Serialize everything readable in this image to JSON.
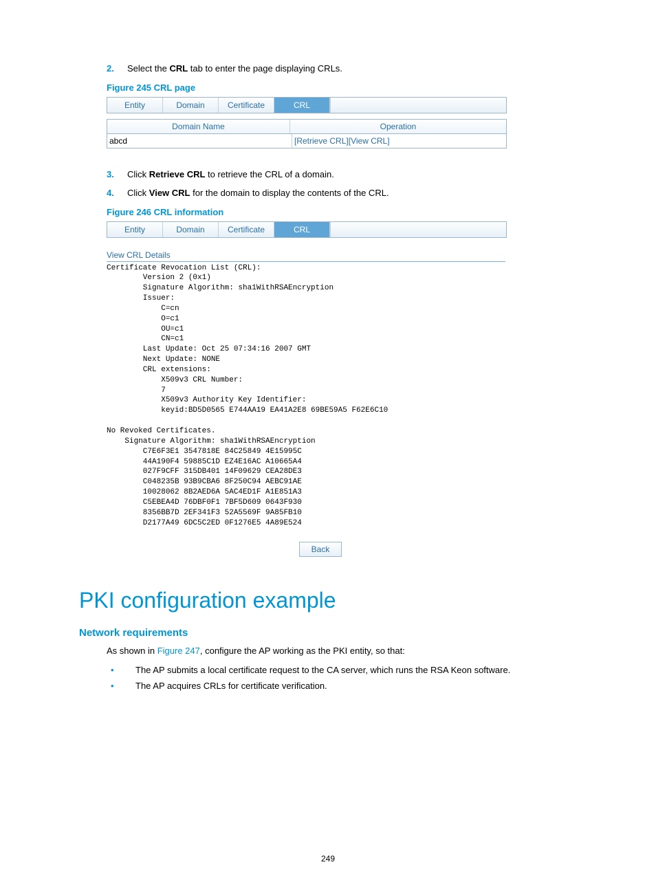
{
  "steps": {
    "s2_num": "2.",
    "s2_a": "Select the ",
    "s2_bold": "CRL",
    "s2_b": " tab to enter the page displaying CRLs.",
    "s3_num": "3.",
    "s3_a": "Click ",
    "s3_bold": "Retrieve CRL",
    "s3_b": " to retrieve the CRL of a domain.",
    "s4_num": "4.",
    "s4_a": "Click ",
    "s4_bold": "View CRL",
    "s4_b": " for the domain to display the contents of the CRL."
  },
  "fig245": {
    "caption": "Figure 245 CRL page",
    "tabs": {
      "entity": "Entity",
      "domain": "Domain",
      "certificate": "Certificate",
      "crl": "CRL"
    },
    "header": {
      "col1": "Domain Name",
      "col2": "Operation"
    },
    "row": {
      "name": "abcd",
      "op_retrieve": "Retrieve CRL",
      "op_view": "View CRL"
    }
  },
  "fig246": {
    "caption": "Figure 246 CRL information",
    "tabs": {
      "entity": "Entity",
      "domain": "Domain",
      "certificate": "Certificate",
      "crl": "CRL"
    },
    "details_label": "View CRL Details",
    "crl_text": "Certificate Revocation List (CRL):\n        Version 2 (0x1)\n        Signature Algorithm: sha1WithRSAEncryption\n        Issuer:\n            C=cn\n            O=c1\n            OU=c1\n            CN=c1\n        Last Update: Oct 25 07:34:16 2007 GMT\n        Next Update: NONE\n        CRL extensions:\n            X509v3 CRL Number:\n            7\n            X509v3 Authority Key Identifier:\n            keyid:BD5D0565 E744AA19 EA41A2E8 69BE59A5 F62E6C10\n\nNo Revoked Certificates.\n    Signature Algorithm: sha1WithRSAEncryption\n        C7E6F3E1 3547818E 84C25849 4E15995C\n        44A190F4 59885C1D EZ4E16AC A10665A4\n        027F9CFF 315DB401 14F09629 CEA28DE3\n        C048235B 93B9CBA6 8F250C94 AEBC91AE\n        10028062 8B2AED6A 5AC4ED1F A1E851A3\n        C5EBEA4D 76DBF0F1 7BF5D609 0643F930\n        8356BB7D 2EF341F3 52A5569F 9A85FB10\n        D2177A49 6DC5C2ED 0F1276E5 4A89E524",
    "back": "Back"
  },
  "pki": {
    "heading": "PKI configuration example",
    "subheading": "Network requirements",
    "intro_a": "As shown in ",
    "intro_link": "Figure 247",
    "intro_b": ", configure the AP working as the PKI entity, so that:",
    "bullet1": "The AP submits a local certificate request to the CA server, which runs the RSA Keon software.",
    "bullet2": "The AP acquires CRLs for certificate verification."
  },
  "page_number": "249"
}
